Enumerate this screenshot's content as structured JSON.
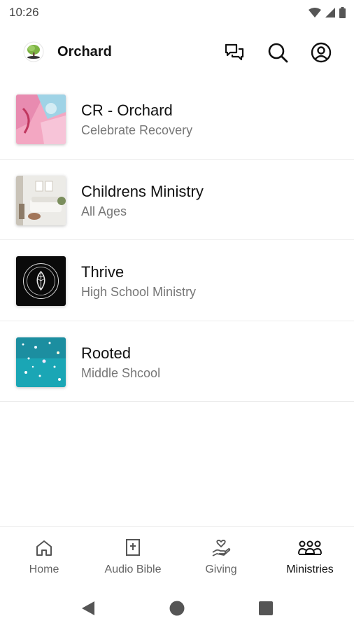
{
  "status": {
    "time": "10:26"
  },
  "app": {
    "title": "Orchard"
  },
  "icons": {
    "logo": "tree-logo-icon",
    "chat": "chat-bubbles-icon",
    "search": "search-icon",
    "account": "account-circle-icon"
  },
  "list": {
    "items": [
      {
        "title": "CR - Orchard",
        "subtitle": "Celebrate Recovery"
      },
      {
        "title": "Childrens Ministry",
        "subtitle": "All Ages"
      },
      {
        "title": "Thrive",
        "subtitle": "High School Ministry"
      },
      {
        "title": "Rooted",
        "subtitle": "Middle Shcool"
      }
    ]
  },
  "bottom_nav": {
    "items": [
      {
        "label": "Home",
        "icon": "home-icon",
        "active": false
      },
      {
        "label": "Audio Bible",
        "icon": "bible-icon",
        "active": false
      },
      {
        "label": "Giving",
        "icon": "giving-hand-icon",
        "active": false
      },
      {
        "label": "Ministries",
        "icon": "group-icon",
        "active": true
      }
    ]
  },
  "colors": {
    "accent_green": "#6aa84f",
    "text": "#111111",
    "subtext": "#777777"
  }
}
